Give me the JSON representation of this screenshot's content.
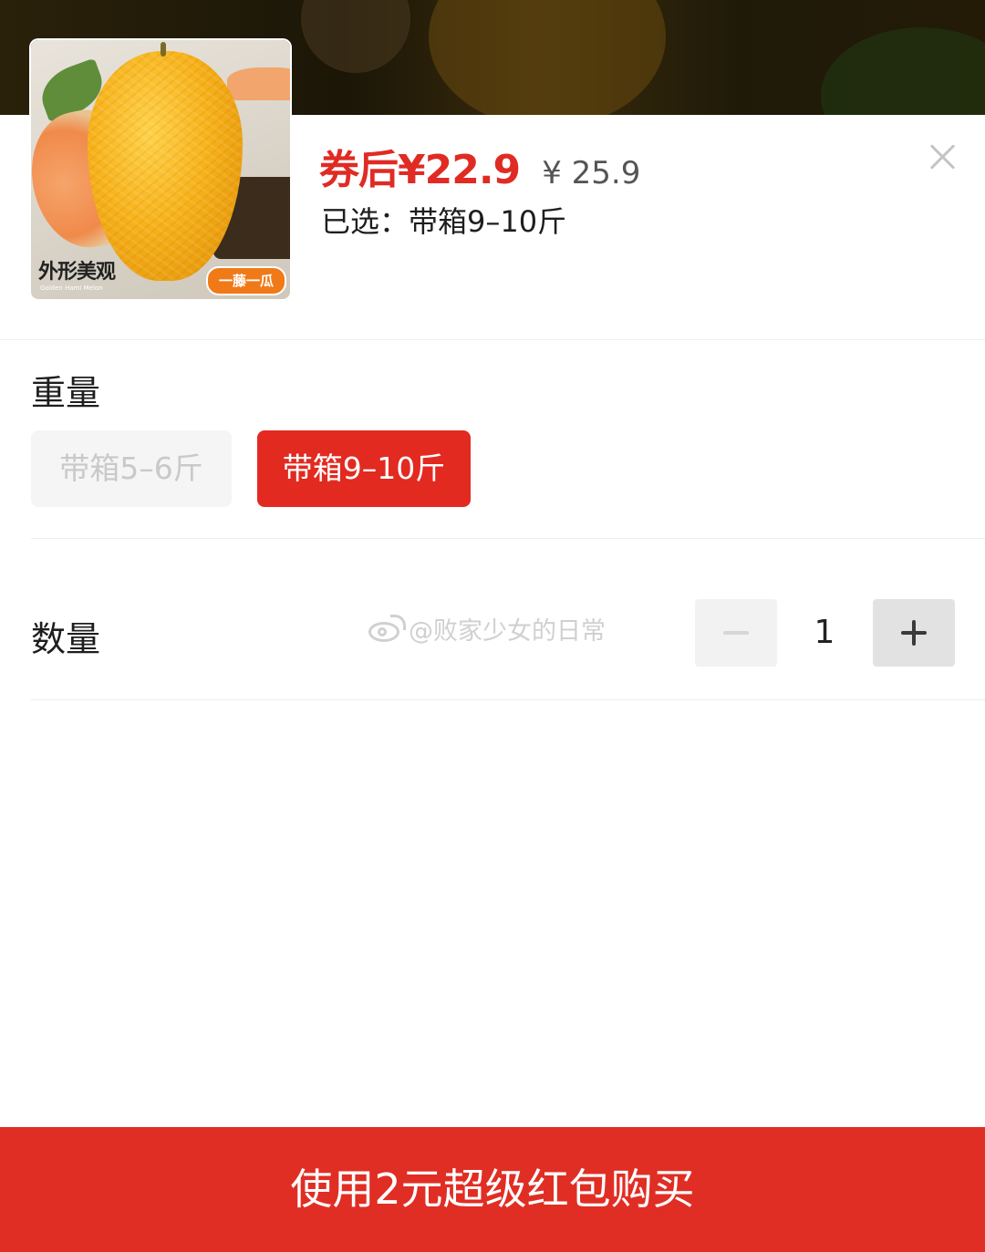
{
  "product": {
    "image_caption_left": "外形美观",
    "image_caption_sub": "Golden Hami Melon",
    "image_caption_right": "一藤一瓜",
    "price_coupon": "券后¥22.9",
    "price_original": "¥ 25.9",
    "selected_text": "已选：带箱9–10斤"
  },
  "close_icon": "close-icon",
  "weight": {
    "title": "重量",
    "options": [
      {
        "label": "带箱5–6斤",
        "state": "disabled"
      },
      {
        "label": "带箱9–10斤",
        "state": "selected"
      }
    ]
  },
  "quantity": {
    "title": "数量",
    "value": "1",
    "minus_icon": "minus-icon",
    "plus_icon": "plus-icon"
  },
  "watermark": {
    "text": "@败家少女的日常",
    "icon": "weibo-icon"
  },
  "buy_button": {
    "label": "使用2元超级红包购买"
  },
  "colors": {
    "accent": "#e02b24",
    "buy_bar": "#e02e24",
    "chip_disabled_bg": "#f5f5f5",
    "chip_disabled_text": "#c9c9c9"
  }
}
